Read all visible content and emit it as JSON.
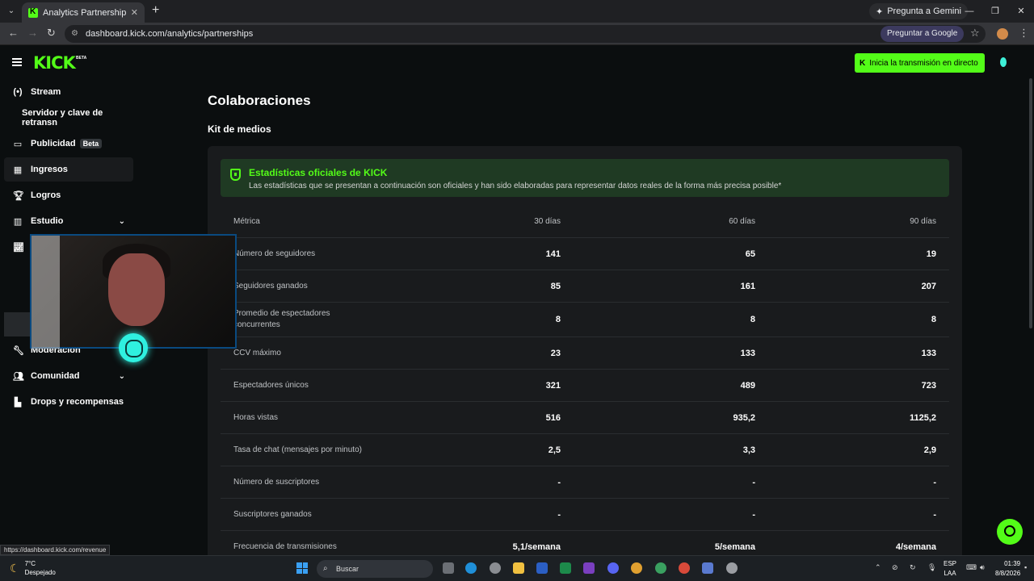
{
  "browser": {
    "tab_title": "Analytics Partnerships - Kick Da",
    "gemini": "Pregunta a Gemini",
    "url": "dashboard.kick.com/analytics/partnerships",
    "ask_google": "Preguntar a Google",
    "status_url": "https://dashboard.kick.com/revenue"
  },
  "header": {
    "logo": "KICK",
    "logo_badge": "BETA",
    "live_button": "Inicia la transmisión en directo"
  },
  "sidebar": {
    "items": [
      {
        "label": "Stream",
        "icon": "broadcast-icon"
      },
      {
        "label": "Servidor y clave de retransn"
      },
      {
        "label": "Publicidad",
        "badge": "Beta",
        "icon": "ad-icon"
      },
      {
        "label": "Ingresos",
        "icon": "revenue-icon"
      },
      {
        "label": "Logros",
        "icon": "trophy-icon"
      },
      {
        "label": "Estudio",
        "icon": "studio-icon"
      },
      {
        "label": "Moderación",
        "icon": "wrench-icon"
      },
      {
        "label": "Comunidad",
        "icon": "community-icon"
      },
      {
        "label": "Drops y recompensas",
        "icon": "drops-icon"
      }
    ]
  },
  "main": {
    "title": "Colaboraciones",
    "section": "Kit de medios",
    "official_title": "Estadísticas oficiales de KICK",
    "official_desc": "Las estadísticas que se presentan a continuación son oficiales y han sido elaboradas para representar datos reales de la forma más precisa posible*"
  },
  "table": {
    "headers": [
      "Métrica",
      "30 días",
      "60 días",
      "90 días"
    ],
    "rows": [
      [
        "Número de seguidores",
        "141",
        "65",
        "19"
      ],
      [
        "Seguidores ganados",
        "85",
        "161",
        "207"
      ],
      [
        "Promedio de espectadores concurrentes",
        "8",
        "8",
        "8"
      ],
      [
        "CCV máximo",
        "23",
        "133",
        "133"
      ],
      [
        "Espectadores únicos",
        "321",
        "489",
        "723"
      ],
      [
        "Horas vistas",
        "516",
        "935,2",
        "1125,2"
      ],
      [
        "Tasa de chat (mensajes por minuto)",
        "2,5",
        "3,3",
        "2,9"
      ],
      [
        "Número de suscriptores",
        "-",
        "-",
        "-"
      ],
      [
        "Suscriptores ganados",
        "-",
        "-",
        "-"
      ],
      [
        "Frecuencia de transmisiones",
        "5,1/semana",
        "5/semana",
        "4/semana"
      ]
    ]
  },
  "taskbar": {
    "temp": "7°C",
    "weather": "Despejado",
    "search": "Buscar",
    "lang1": "ESP",
    "lang2": "LAA",
    "time": "01:39",
    "date": "8/8/2026"
  }
}
